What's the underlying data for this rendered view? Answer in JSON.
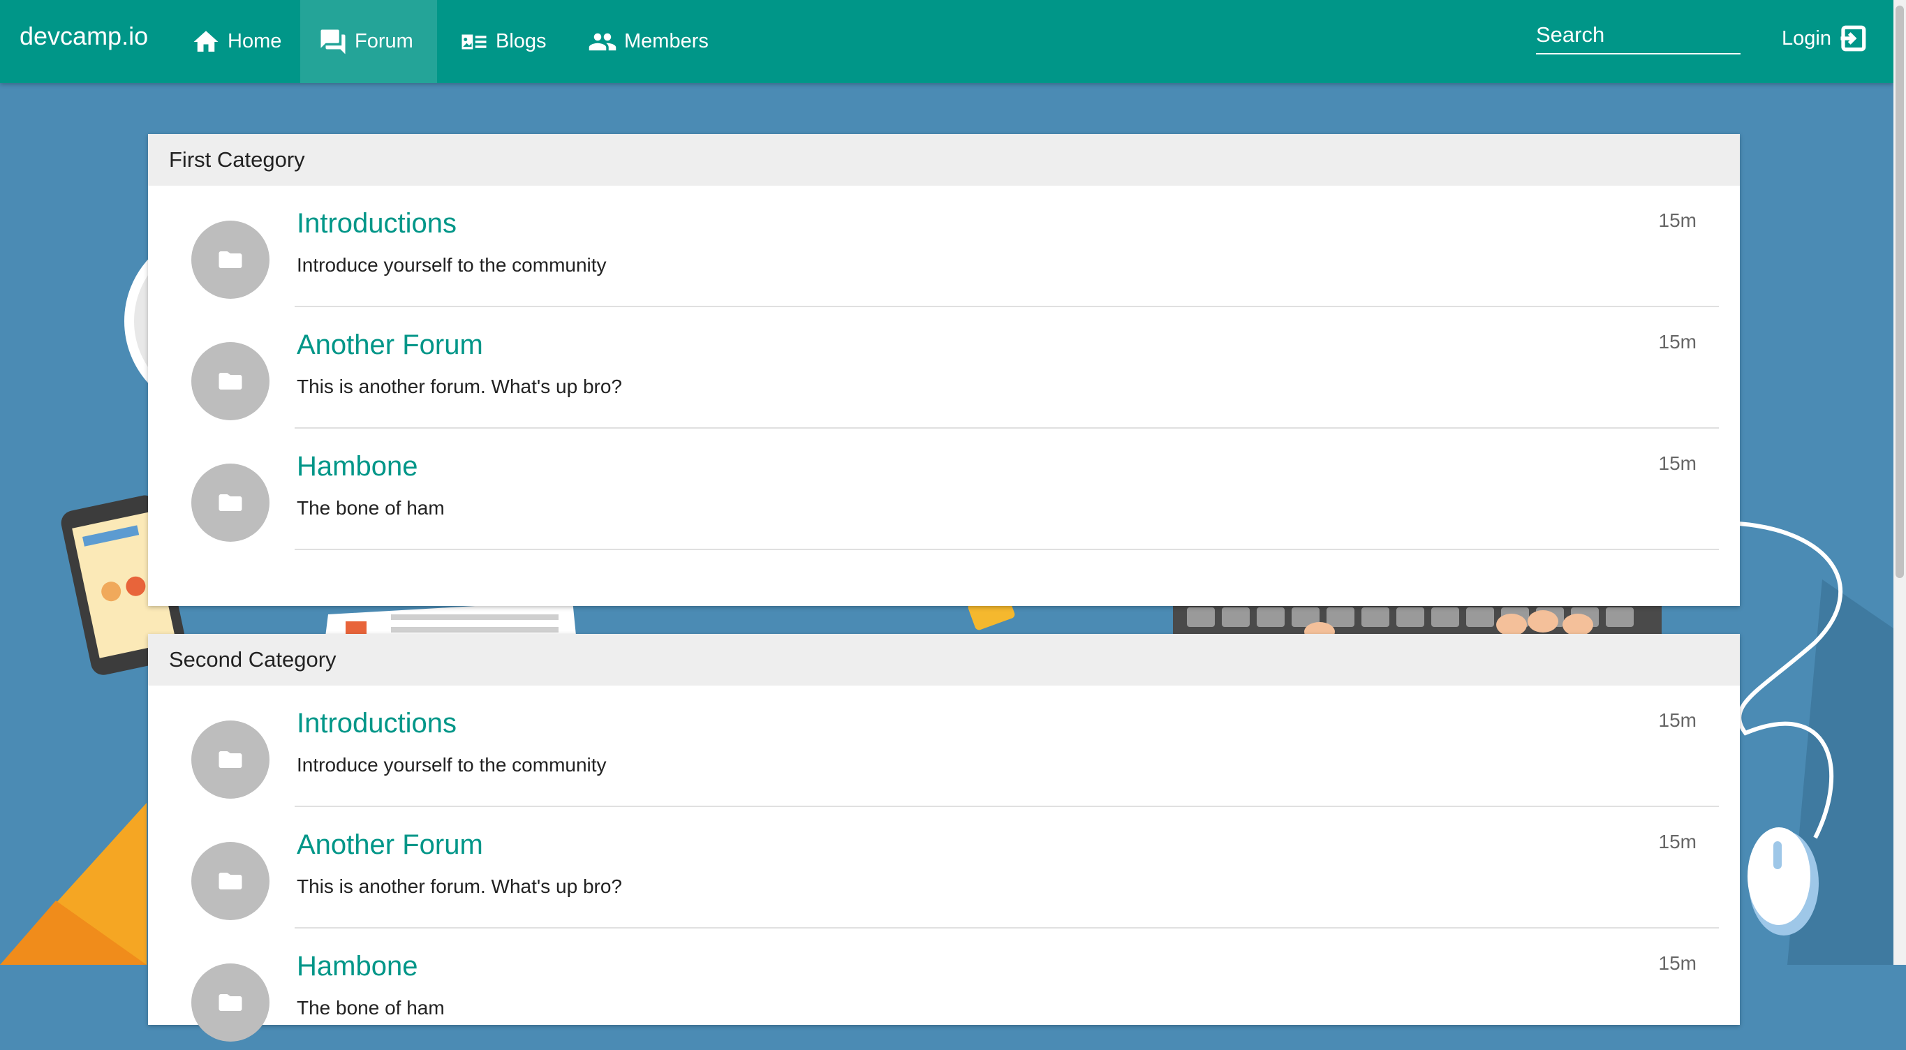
{
  "brand": "devcamp.io",
  "nav": {
    "items": [
      {
        "label": "Home",
        "icon": "home-icon"
      },
      {
        "label": "Forum",
        "icon": "forum-icon",
        "active": true
      },
      {
        "label": "Blogs",
        "icon": "blog-icon"
      },
      {
        "label": "Members",
        "icon": "members-icon"
      }
    ],
    "search_placeholder": "Search",
    "login_label": "Login"
  },
  "colors": {
    "primary": "#009688",
    "background": "#4b8bb4",
    "avatar": "#bdbdbd",
    "header_bg": "#eeeeee"
  },
  "categories": [
    {
      "title": "First Category",
      "forums": [
        {
          "title": "Introductions",
          "description": "Introduce yourself to the community",
          "time": "15m",
          "icon": "folder-icon"
        },
        {
          "title": "Another Forum",
          "description": "This is another forum. What's up bro?",
          "time": "15m",
          "icon": "folder-icon"
        },
        {
          "title": "Hambone",
          "description": "The bone of ham",
          "time": "15m",
          "icon": "folder-icon"
        }
      ]
    },
    {
      "title": "Second Category",
      "forums": [
        {
          "title": "Introductions",
          "description": "Introduce yourself to the community",
          "time": "15m",
          "icon": "folder-icon"
        },
        {
          "title": "Another Forum",
          "description": "This is another forum. What's up bro?",
          "time": "15m",
          "icon": "folder-icon"
        },
        {
          "title": "Hambone",
          "description": "The bone of ham",
          "time": "15m",
          "icon": "folder-icon"
        }
      ]
    }
  ]
}
